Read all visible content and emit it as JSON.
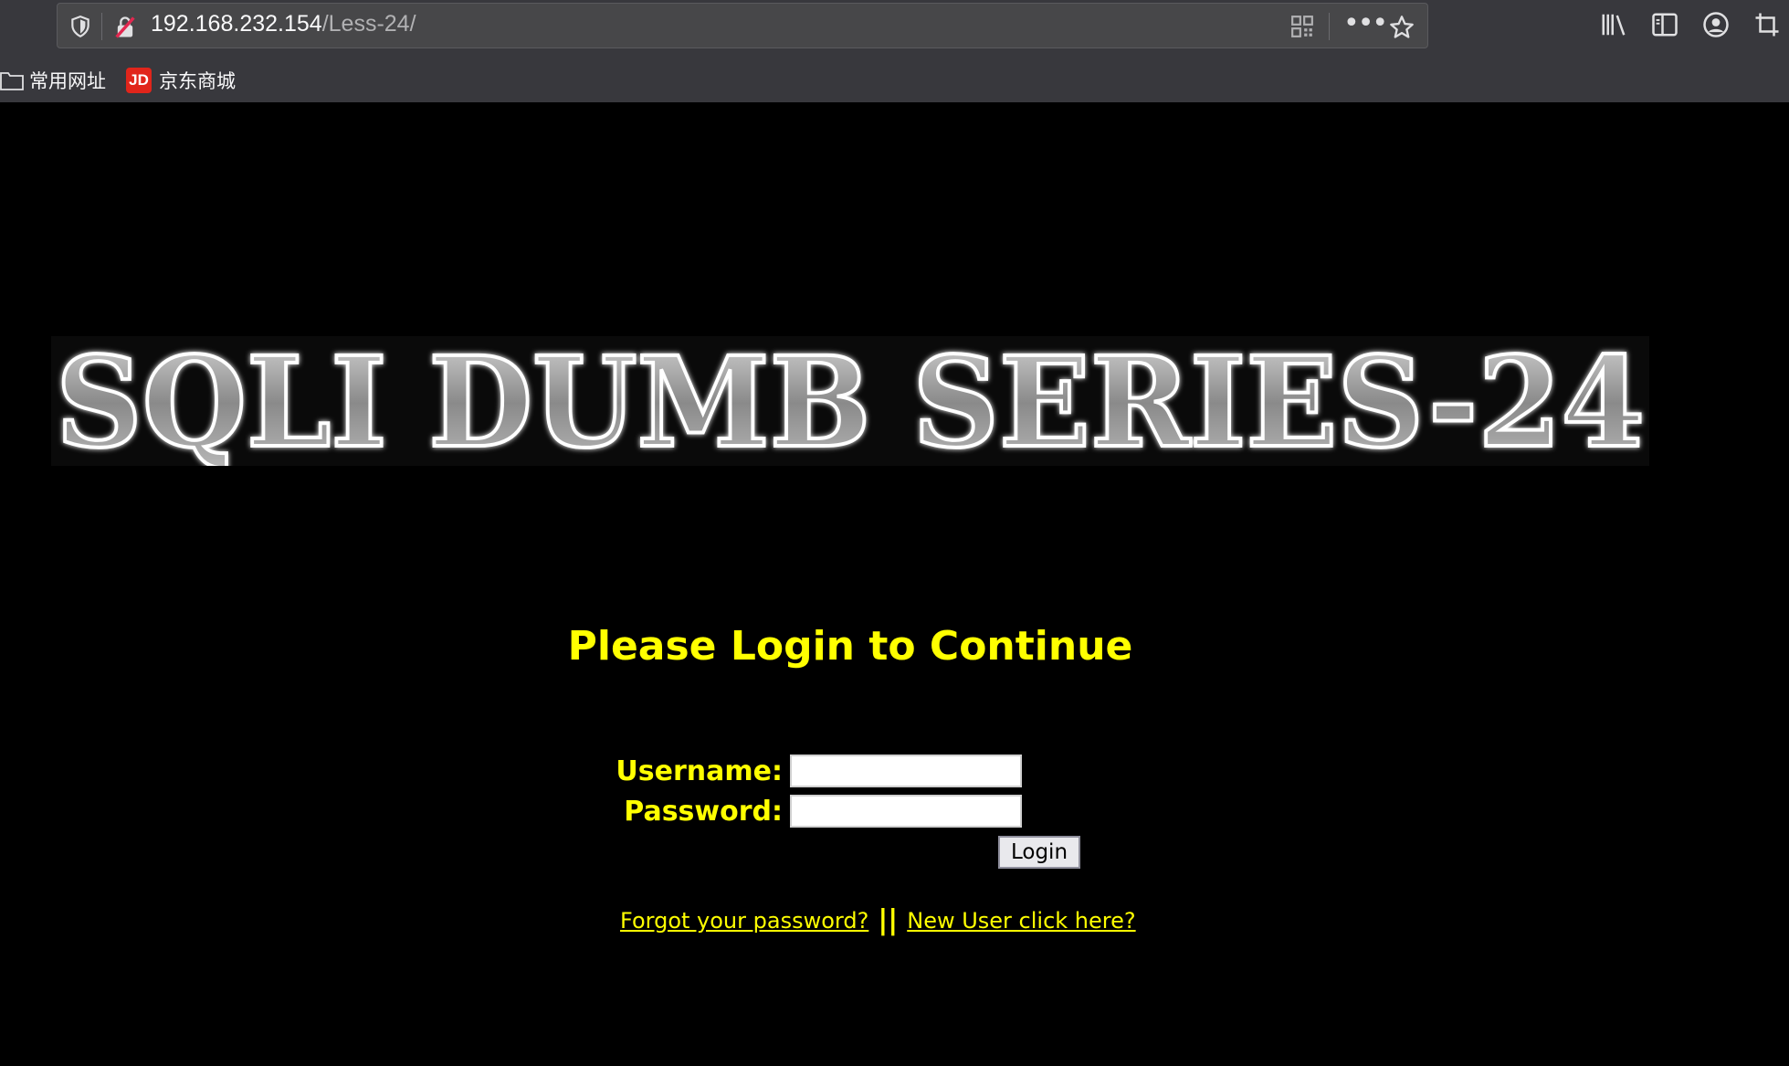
{
  "browser": {
    "url_host": "192.168.232.154",
    "url_path": "/Less-24/",
    "icons": {
      "shield": "shield-icon",
      "insecure": "insecure-lock-icon",
      "qr": "qr-code-icon",
      "more": "more-actions-icon",
      "star": "bookmark-star-icon",
      "library": "library-icon",
      "sidebar": "sidebar-icon",
      "account": "account-icon",
      "crop": "screenshot-crop-icon"
    }
  },
  "bookmarks": [
    {
      "label": "常用网址",
      "icon": "folder-icon"
    },
    {
      "label": "京东商城",
      "icon": "jd-logo",
      "badge": "JD"
    }
  ],
  "page": {
    "banner_text": "SQLI DUMB SERIES-24",
    "title": "Please Login to Continue",
    "username_label": "Username:",
    "password_label": "Password:",
    "username_value": "",
    "password_value": "",
    "login_button": "Login",
    "forgot_link": "Forgot your password?",
    "separator": "||",
    "new_user_link": "New User click here?"
  },
  "colors": {
    "page_bg": "#000000",
    "accent_text": "#ffff00",
    "chrome_bg": "#38383d"
  }
}
